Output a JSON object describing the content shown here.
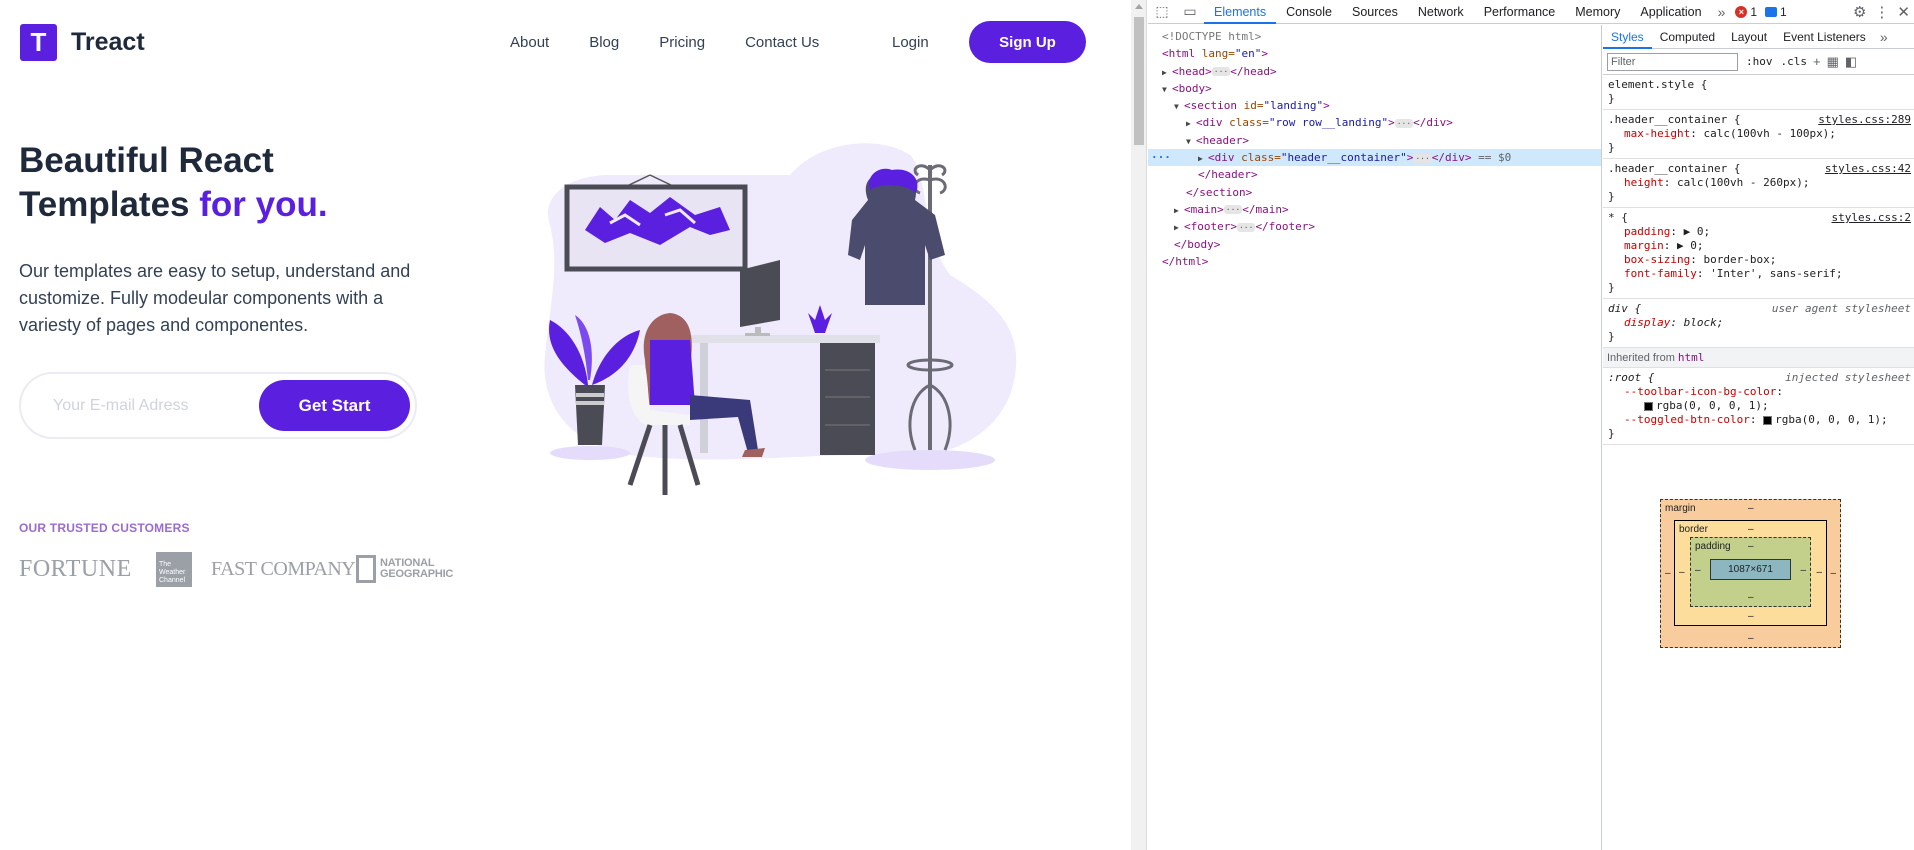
{
  "site": {
    "logo_letter": "T",
    "brand": "Treact",
    "nav": {
      "about": "About",
      "blog": "Blog",
      "pricing": "Pricing",
      "contact": "Contact Us",
      "login": "Login",
      "signup": "Sign Up"
    },
    "hero": {
      "title_line1": "Beautiful React",
      "title_line2_a": "Templates ",
      "title_line2_b": "for you.",
      "description": "Our templates are easy to setup, understand and customize. Fully modeular components with a variesty of pages and componentes.",
      "email_placeholder": "Your E-mail Adress",
      "cta": "Get Start"
    },
    "trusted_heading": "OUR TRUSTED CUSTOMERS",
    "customers": {
      "fortune": "FORTUNE",
      "weather_1": "The",
      "weather_2": "Weather",
      "weather_3": "Channel",
      "fastco": "FAST COMPANY",
      "natgeo_1": "NATIONAL",
      "natgeo_2": "GEOGRAPHIC"
    },
    "colors": {
      "brand": "#5b1fe0",
      "accent_text": "#9b6bd0",
      "logo_gray": "#9aa0a6"
    }
  },
  "devtools": {
    "tabs": [
      "Elements",
      "Console",
      "Sources",
      "Network",
      "Performance",
      "Memory",
      "Application"
    ],
    "error_count": "1",
    "message_count": "1",
    "dom": {
      "doctype": "<!DOCTYPE html>",
      "html_open": "<html",
      "html_attr": " lang=",
      "html_val": "\"en\"",
      "head": "<head>",
      "head_close": "</head>",
      "body_open": "<body>",
      "section_open": "<section",
      "section_attr": " id=",
      "section_val": "\"landing\"",
      "div_open": "<div",
      "div_attr": " class=",
      "div_val": "\"row row__landing\"",
      "div_close": "</div>",
      "header_open": "<header>",
      "hc_open": "<div",
      "hc_attr": " class=",
      "hc_val": "\"header__container\"",
      "hc_close": "</div>",
      "hc_eq": " == $0",
      "header_close": "</header>",
      "section_close": "</section>",
      "main_open": "<main>",
      "main_close": "</main>",
      "footer_open": "<footer>",
      "footer_close": "</footer>",
      "body_close": "</body>",
      "html_close": "</html>"
    },
    "styles_tabs": [
      "Styles",
      "Computed",
      "Layout",
      "Event Listeners"
    ],
    "filter_placeholder": "Filter",
    "hov": ":hov",
    "cls": ".cls",
    "rules": {
      "element_style": "element.style {",
      "r1_sel": ".header__container {",
      "r1_src": "styles.css:289",
      "r1_p1n": "max-height",
      "r1_p1v": ": calc(100vh - 100px);",
      "r2_sel": ".header__container {",
      "r2_src": "styles.css:42",
      "r2_p1n": "height",
      "r2_p1v": ": calc(100vh - 260px);",
      "r3_sel": "* {",
      "r3_src": "styles.css:2",
      "r3_p1n": "padding",
      "r3_p1v": ": ▶ 0;",
      "r3_p2n": "margin",
      "r3_p2v": ": ▶ 0;",
      "r3_p3n": "box-sizing",
      "r3_p3v": ": border-box;",
      "r3_p4n": "font-family",
      "r3_p4v": ": 'Inter', sans-serif;",
      "r4_sel": "div {",
      "r4_src": "user agent stylesheet",
      "r4_p1n": "display",
      "r4_p1v": ": block;",
      "inherited_label": "Inherited from ",
      "inherited_tag": "html",
      "r5_sel": ":root {",
      "r5_src": "injected stylesheet",
      "r5_p1n": "--toolbar-icon-bg-color",
      "r5_p1v": "rgba(0, 0, 0, 1);",
      "r5_p2n": "--toggled-btn-color",
      "r5_p2v": "rgba(0, 0, 0, 1);",
      "close": "}"
    },
    "boxmodel": {
      "margin_label": "margin",
      "border_label": "border",
      "padding_label": "padding",
      "content": "1087×671",
      "dash": "–"
    }
  }
}
